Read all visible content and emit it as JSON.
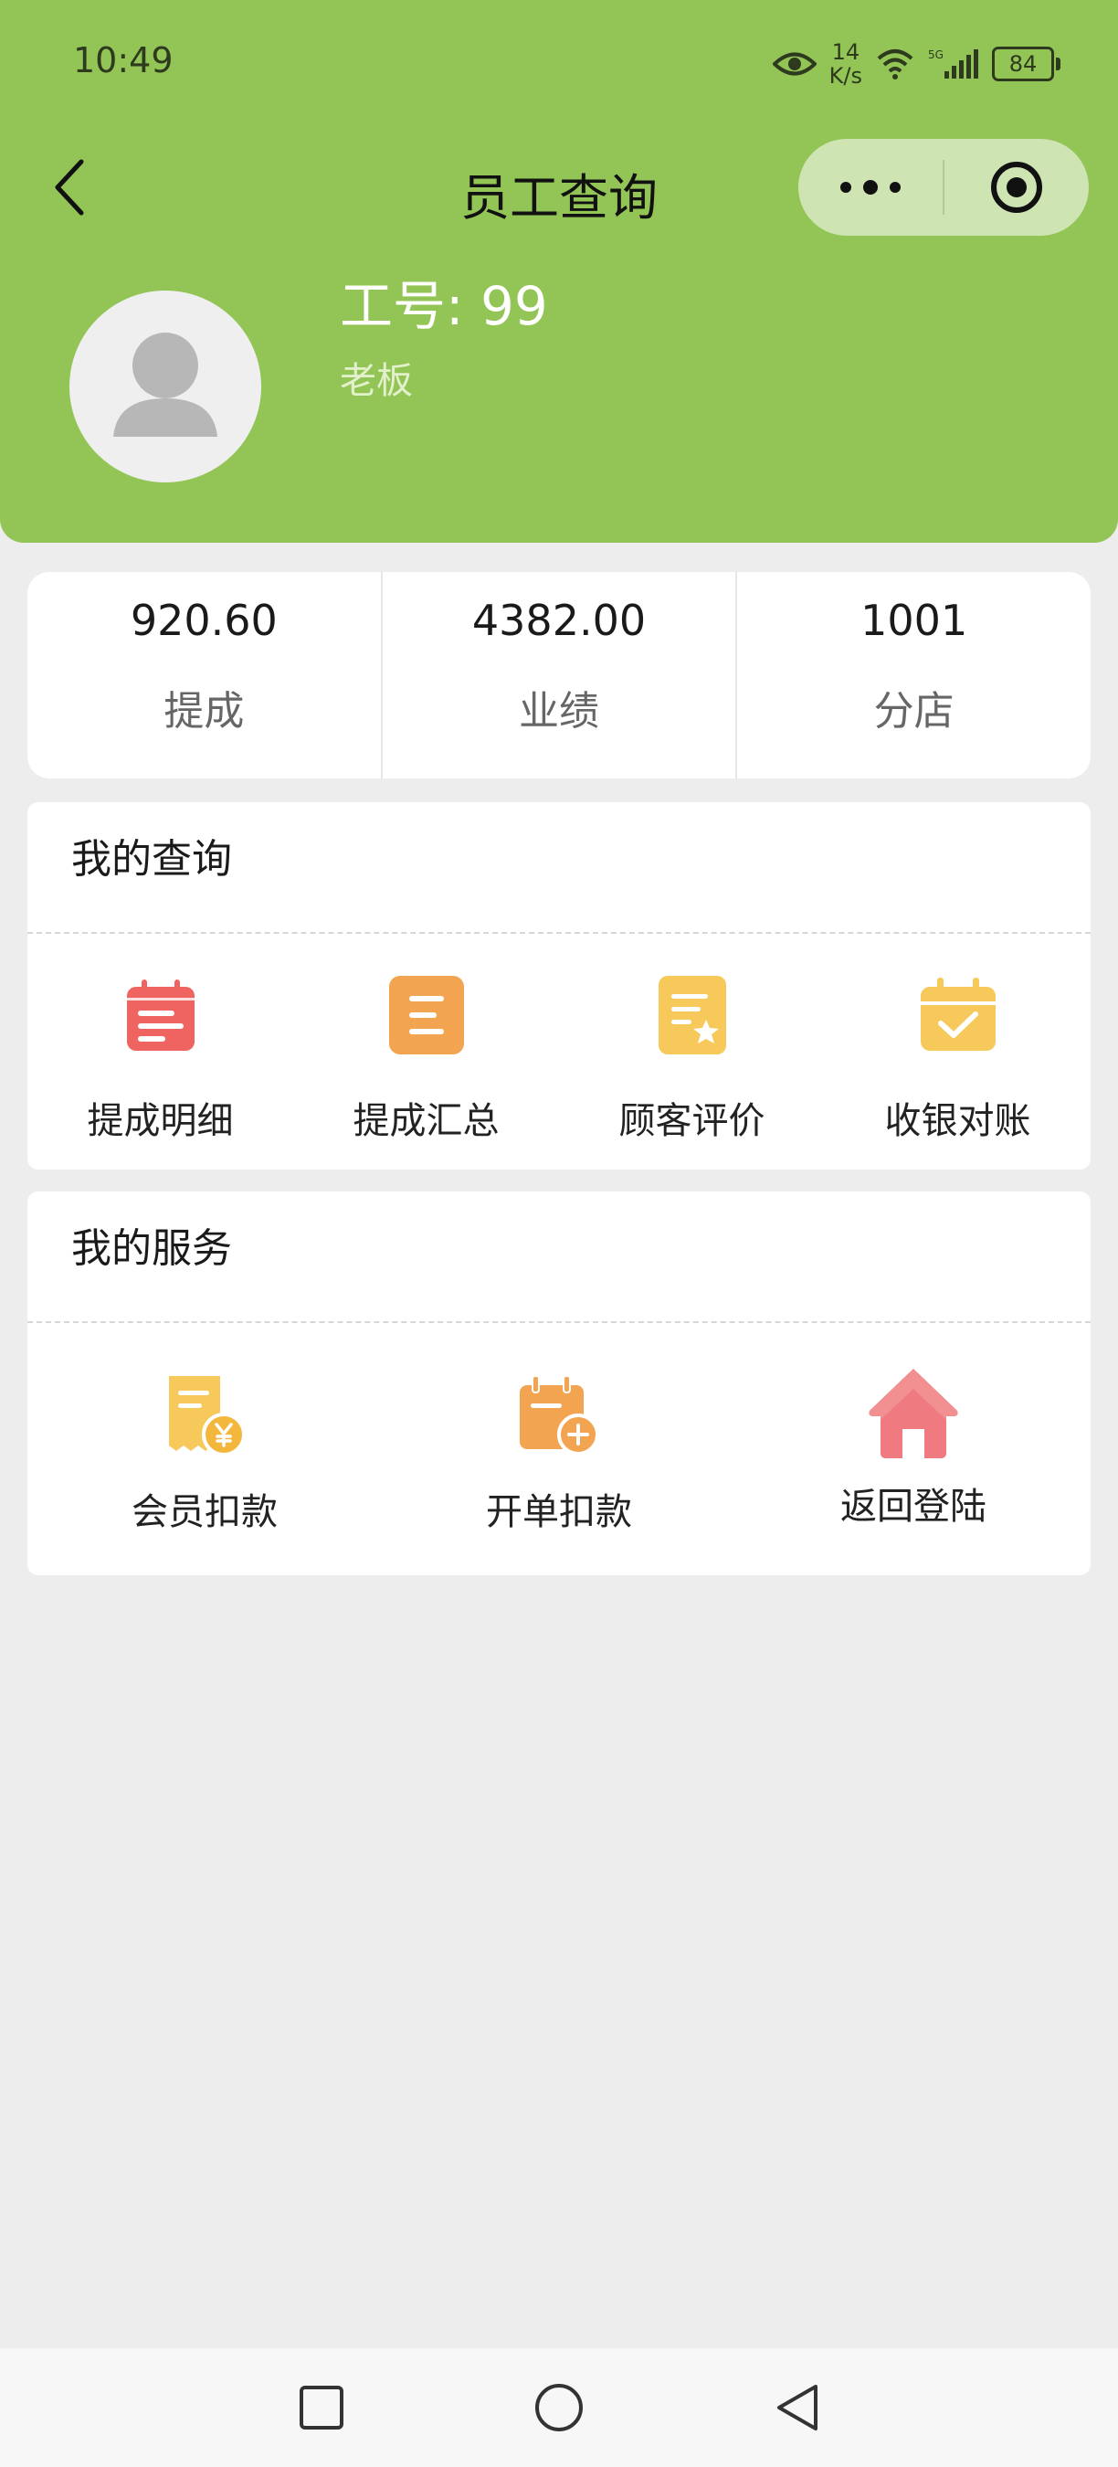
{
  "status_bar": {
    "time": "10:49",
    "net_speed_value": "14",
    "net_speed_unit": "K/s",
    "battery": "84"
  },
  "navbar": {
    "title": "员工查询"
  },
  "profile": {
    "employee_label": "工号: 99",
    "role": "老板"
  },
  "stats": [
    {
      "value": "920.60",
      "label": "提成"
    },
    {
      "value": "4382.00",
      "label": "业绩"
    },
    {
      "value": "1001",
      "label": "分店"
    }
  ],
  "my_queries": {
    "title": "我的查询",
    "items": [
      {
        "label": "提成明细",
        "icon": "calendar-list-icon",
        "color": "#ef6461"
      },
      {
        "label": "提成汇总",
        "icon": "document-list-icon",
        "color": "#f2a451"
      },
      {
        "label": "顾客评价",
        "icon": "document-star-icon",
        "color": "#f7c95b"
      },
      {
        "label": "收银对账",
        "icon": "calendar-check-icon",
        "color": "#f7c95b"
      }
    ]
  },
  "my_services": {
    "title": "我的服务",
    "items": [
      {
        "label": "会员扣款",
        "icon": "receipt-yen-icon",
        "color": "#f7c95b"
      },
      {
        "label": "开单扣款",
        "icon": "calendar-plus-icon",
        "color": "#f2a451"
      },
      {
        "label": "返回登陆",
        "icon": "home-icon",
        "color": "#ef7a7f"
      }
    ]
  },
  "colors": {
    "header_green": "#93c456",
    "page_bg": "#ededed"
  }
}
